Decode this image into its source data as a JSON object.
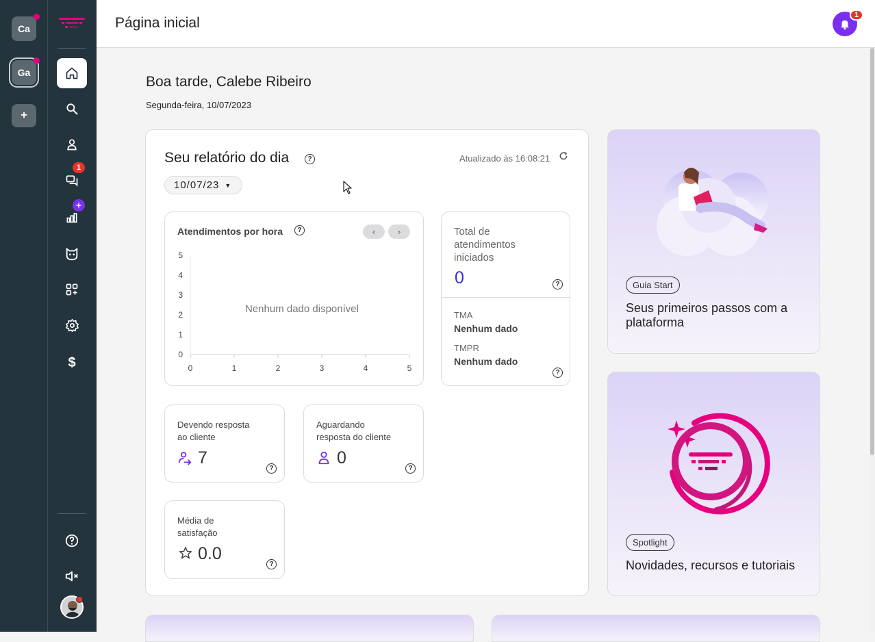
{
  "workspaces": [
    {
      "label": "Ca",
      "notify": true
    },
    {
      "label": "Ga",
      "notify": true,
      "active": true
    },
    {
      "label": "+"
    }
  ],
  "nav": {
    "badges": {
      "chats": "1"
    }
  },
  "header": {
    "title": "Página inicial",
    "notifications": "1"
  },
  "greeting": {
    "text": "Boa tarde, Calebe Ribeiro",
    "date": "Segunda-feira, 10/07/2023"
  },
  "report": {
    "title": "Seu relatório do dia",
    "updated": "Atualizado às 16:08:21",
    "date_select": "10/07/23",
    "hourly": {
      "title": "Atendimentos por hora",
      "empty": "Nenhum dado disponível"
    },
    "total": {
      "label": "Total de atendimentos iniciados",
      "value": "0"
    },
    "tma": {
      "label": "TMA",
      "value": "Nenhum dado"
    },
    "tmpr": {
      "label": "TMPR",
      "value": "Nenhum dado"
    },
    "owing": {
      "label1": "Devendo resposta",
      "label2": "ao cliente",
      "value": "7"
    },
    "waiting": {
      "label1": "Aguardando",
      "label2": "resposta do cliente",
      "value": "0"
    },
    "satisfaction": {
      "label1": "Média de",
      "label2": "satisfação",
      "value": "0.0"
    }
  },
  "chart_data": {
    "type": "bar",
    "title": "Atendimentos por hora",
    "x": [
      "0",
      "1",
      "2",
      "3",
      "4",
      "5"
    ],
    "y_ticks": [
      "0",
      "1",
      "2",
      "3",
      "4",
      "5"
    ],
    "ylim": [
      0,
      5
    ],
    "series": [],
    "annotation": "Nenhum dado disponível"
  },
  "promo1": {
    "tag": "Guia Start",
    "title": "Seus primeiros passos com a plataforma"
  },
  "promo2": {
    "tag": "Spotlight",
    "title": "Novidades, recursos e tutoriais"
  },
  "colors": {
    "accent": "#7a2ff0",
    "brand_pink": "#e6007e",
    "sidebar": "#24343d",
    "link_blue": "#3a2fd0"
  }
}
